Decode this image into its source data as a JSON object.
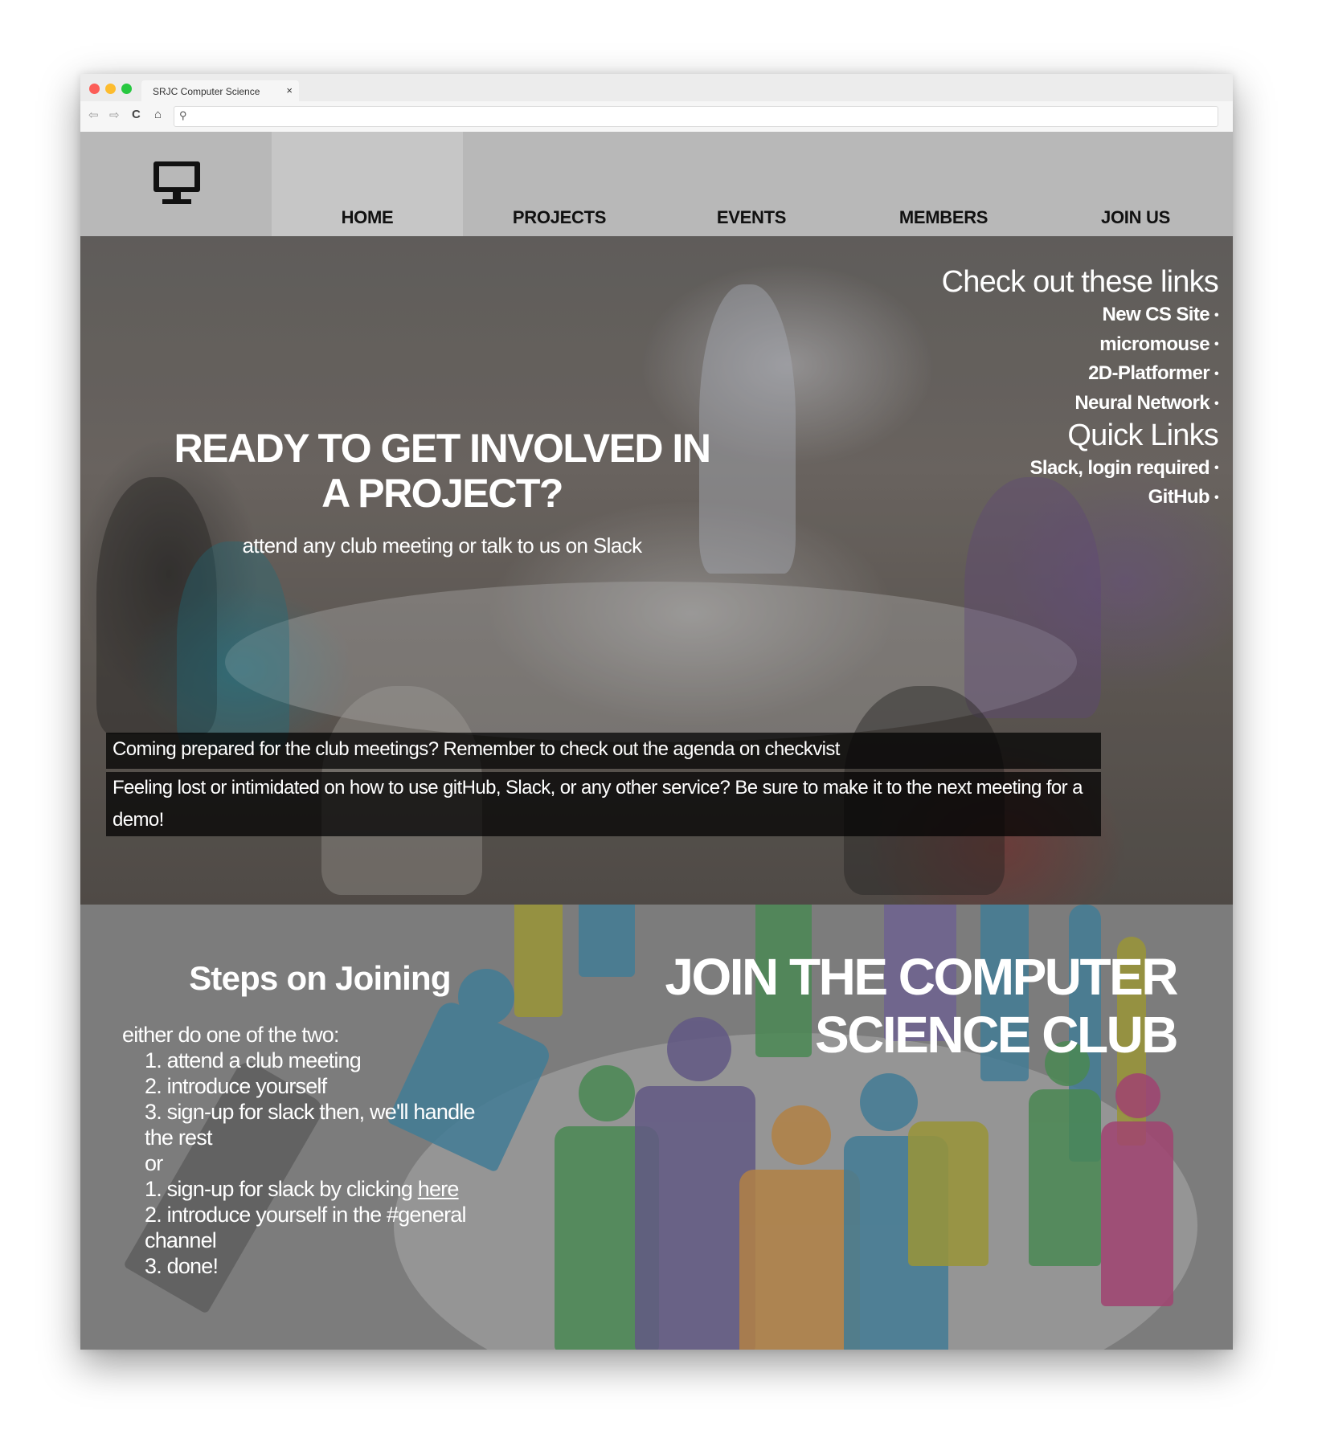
{
  "browser": {
    "tab_title": "SRJC Computer Science",
    "tab_close": "×",
    "back": "⇦",
    "forward": "⇨",
    "reload": "C",
    "home": "⌂",
    "search_icon": "⚲",
    "url": ""
  },
  "nav": {
    "logo_icon": "monitor-icon",
    "items": [
      {
        "label": "HOME",
        "active": true
      },
      {
        "label": "PROJECTS",
        "active": false
      },
      {
        "label": "EVENTS",
        "active": false
      },
      {
        "label": "MEMBERS",
        "active": false
      },
      {
        "label": "JOIN US",
        "active": false
      }
    ]
  },
  "hero": {
    "headline": "READY TO GET INVOLVED IN A PROJECT?",
    "subheadline": "attend any club meeting or talk to us on Slack",
    "links_title": "Check out these links",
    "links": [
      "New CS Site",
      "micromouse",
      "2D-Platformer",
      "Neural Network"
    ],
    "quick_title": "Quick Links",
    "quick_links": [
      "Slack, login required",
      "GitHub"
    ],
    "bullet": "•",
    "notices": [
      "Coming prepared for the club meetings? Remember to check out the agenda on checkvist",
      "Feeling lost or intimidated on how to use gitHub, Slack, or any other service? Be sure to make it to the next meeting for a demo!"
    ]
  },
  "join": {
    "steps_title": "Steps on Joining",
    "intro": "either do one of the two:",
    "option_a": [
      "1. attend a club meeting",
      "2. introduce yourself",
      "3. sign-up for slack then, we'll handle the rest"
    ],
    "or": "or",
    "option_b_1_prefix": "1. sign-up for slack by clicking ",
    "option_b_1_link": "here",
    "option_b_rest": [
      "2. introduce yourself in the #general channel",
      "3. done!"
    ],
    "headline": "JOIN THE COMPUTER SCIENCE CLUB"
  },
  "colors": {
    "nav_bg": "#b8b8b8",
    "nav_active": "#c6c6c6",
    "section_bg": "#7e7e7e",
    "text_light": "#ffffff"
  }
}
